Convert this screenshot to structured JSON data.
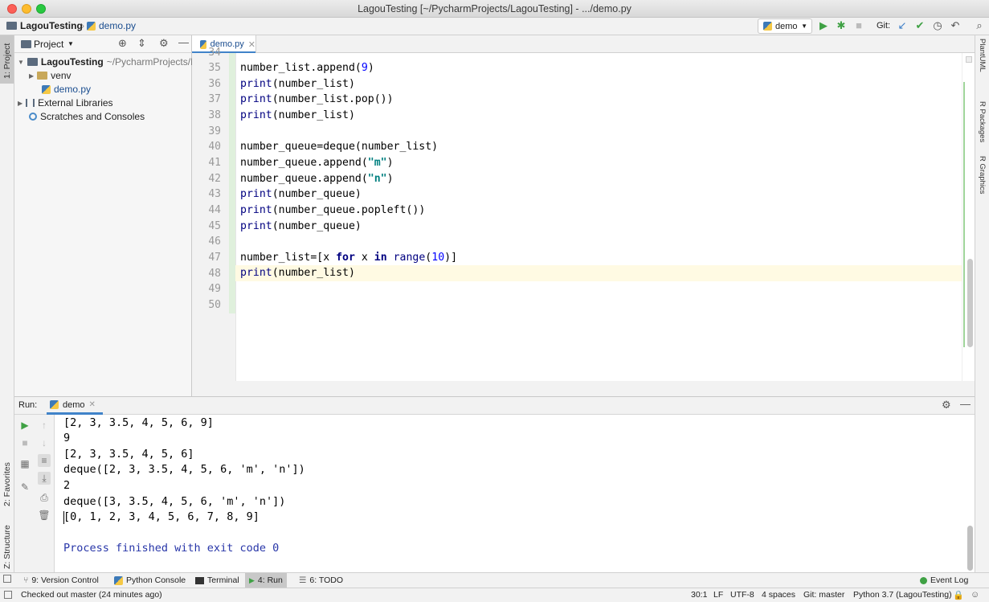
{
  "window": {
    "title": "LagouTesting [~/PycharmProjects/LagouTesting] - .../demo.py"
  },
  "navbar": {
    "project": "LagouTesting",
    "file": "demo.py",
    "run_config": "demo",
    "git_label": "Git:"
  },
  "left_stripe": {
    "project_tab": "1: Project",
    "favorites_tab": "2: Favorites",
    "structure_tab": "Z: Structure"
  },
  "right_stripe": {
    "plantuml": "PlantUML",
    "r_packages": "R Packages",
    "r_graphics": "R Graphics"
  },
  "project_panel": {
    "title": "Project",
    "root_name": "LagouTesting",
    "root_path": "~/PycharmProjects/L",
    "venv": "venv",
    "demo_file": "demo.py",
    "external_libraries": "External Libraries",
    "scratches": "Scratches and Consoles"
  },
  "editor": {
    "tab_label": "demo.py",
    "partial_line_number": "34",
    "line_numbers": [
      "35",
      "36",
      "37",
      "38",
      "39",
      "40",
      "41",
      "42",
      "43",
      "44",
      "45",
      "46",
      "47",
      "48",
      "49",
      "50"
    ],
    "code_lines": [
      "number_list.append(9)",
      "print(number_list)",
      "print(number_list.pop())",
      "print(number_list)",
      "",
      "number_queue=deque(number_list)",
      "number_queue.append(\"m\")",
      "number_queue.append(\"n\")",
      "print(number_queue)",
      "print(number_queue.popleft())",
      "print(number_queue)",
      "",
      "number_list=[x for x in range(10)]",
      "print(number_list)",
      "",
      ""
    ]
  },
  "run_panel": {
    "label": "Run:",
    "tab": "demo",
    "output": [
      "[2, 3, 3.5, 4, 5, 6, 9]",
      "9",
      "[2, 3, 3.5, 4, 5, 6]",
      "deque([2, 3, 3.5, 4, 5, 6, 'm', 'n'])",
      "2",
      "deque([3, 3.5, 4, 5, 6, 'm', 'n'])",
      "[0, 1, 2, 3, 4, 5, 6, 7, 8, 9]",
      ""
    ],
    "exit_message": "Process finished with exit code 0"
  },
  "tool_tabs": {
    "version_control": "9: Version Control",
    "python_console": "Python Console",
    "terminal": "Terminal",
    "run": "4: Run",
    "todo": "6: TODO",
    "event_log": "Event Log"
  },
  "status_bar": {
    "message": "Checked out master (24 minutes ago)",
    "position": "30:1",
    "line_sep": "LF",
    "encoding": "UTF-8",
    "indent": "4 spaces",
    "git_branch": "Git: master",
    "interpreter": "Python 3.7 (LagouTesting)"
  },
  "colors": {
    "accent": "#4083c9",
    "run_green": "#3fa144",
    "keyword": "#000080",
    "number": "#0000ff",
    "string": "#008080"
  }
}
